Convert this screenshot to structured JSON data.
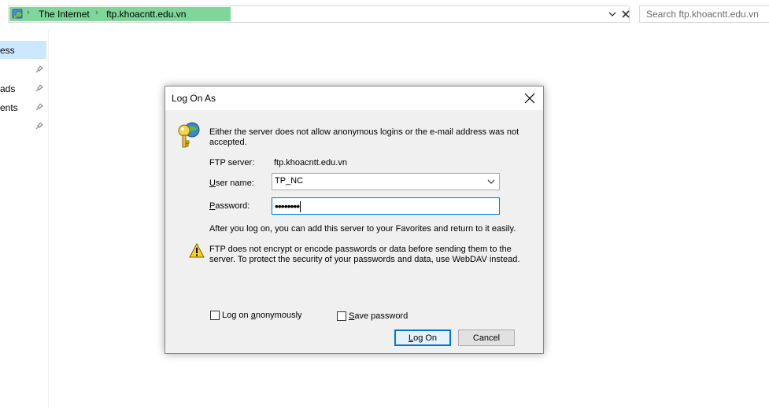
{
  "address_bar": {
    "breadcrumb": [
      "The Internet",
      "ftp.khoacntt.edu.vn"
    ],
    "icon": "internet-globe-icon"
  },
  "search": {
    "placeholder": "Search ftp.khoacntt.edu.vn"
  },
  "nav_pane": {
    "items": [
      {
        "label": "ess",
        "selected": true
      },
      {
        "label": "",
        "pinned": true
      },
      {
        "label": "ads",
        "pinned": true
      },
      {
        "label": "ents",
        "pinned": true
      },
      {
        "label": "",
        "pinned": true
      }
    ]
  },
  "dialog": {
    "title": "Log On As",
    "message_line1": "Either the server does not allow anonymous logins or the e-mail address was not",
    "message_line2": "accepted.",
    "ftp_server_label": "FTP server:",
    "ftp_server_value": "ftp.khoacntt.edu.vn",
    "username_label_first": "U",
    "username_label_rest": "ser name:",
    "username_value": "TP_NC",
    "password_label_first": "P",
    "password_label_rest": "assword:",
    "password_mask": "••••••••",
    "info_text": "After you log on, you can add this server to your Favorites and return to it easily.",
    "warning_line1": "FTP does not encrypt or encode passwords or data before sending them to the",
    "warning_line2": "server.  To protect the security of your passwords and data, use WebDAV instead.",
    "anon_label_pre": "Log on ",
    "anon_label_ul": "a",
    "anon_label_post": "nonymously",
    "anon_checked": false,
    "save_label_ul": "S",
    "save_label_post": "ave password",
    "save_checked": false,
    "logon_ul": "L",
    "logon_post": "og On",
    "cancel_label": "Cancel"
  },
  "colors": {
    "address_highlight": "#7fd59a",
    "nav_selected": "#cce8ff",
    "focus_blue": "#0078d7",
    "dialog_bg": "#f0f0f0"
  }
}
